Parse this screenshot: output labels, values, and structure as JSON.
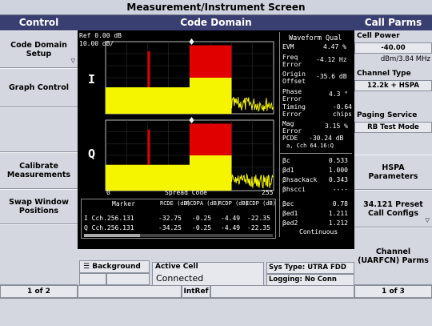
{
  "window": {
    "title": "Measurement/Instrument Screen"
  },
  "left_panel": {
    "header": "Control",
    "keys": [
      {
        "label": "Code Domain Setup",
        "has_menu": true
      },
      {
        "label": "Graph Control",
        "has_menu": false
      },
      {
        "label": "",
        "has_menu": false
      },
      {
        "label": "Calibrate Measurements",
        "has_menu": false
      },
      {
        "label": "Swap Window Positions",
        "has_menu": false
      },
      {
        "label": "",
        "has_menu": false
      }
    ],
    "page_indicator": "1 of 2"
  },
  "center": {
    "header": "Code Domain",
    "ref_label": "Ref 0.00 dB",
    "scale_label": "10.00 dB/",
    "i_label": "I",
    "q_label": "Q",
    "axis_start": "0",
    "axis_title": "Spread Code",
    "axis_end": "255",
    "table": {
      "headers": [
        "Marker",
        "RCDE (dB)",
        "RCDPA (dB)",
        "RCDP (dB)",
        "ECDP (dB)"
      ],
      "rows": [
        [
          "I Cch.256.131",
          "-32.75",
          "-0.25",
          "-4.49",
          "-22.35"
        ],
        [
          "Q Cch.256.131",
          "-34.25",
          "-0.25",
          "-4.49",
          "-22.35"
        ]
      ]
    },
    "waveform": {
      "title": "Waveform Qual",
      "rows": [
        {
          "label": "EVM",
          "value": "4.47 %"
        },
        {
          "label": "Freq Error",
          "value": "-4.12 Hz"
        },
        {
          "label": "Origin Offset",
          "value": "-35.6 dB"
        },
        {
          "label": "Phase Error",
          "value": "4.3 °"
        },
        {
          "label": "Timing Error",
          "value": "-0.64 chips"
        },
        {
          "label": "Mag Error",
          "value": "3.15 %"
        },
        {
          "label": "PCDE",
          "value": "-30.24 dB"
        },
        {
          "label": "",
          "value": "a, Cch 64.16:Q"
        }
      ],
      "gains": [
        {
          "label": "βc",
          "value": "0.533"
        },
        {
          "label": "βd1",
          "value": "1.000"
        },
        {
          "label": "βhsackack",
          "value": "0.343"
        },
        {
          "label": "βhscci",
          "value": "----"
        },
        {
          "label": "βec",
          "value": "0.78"
        },
        {
          "label": "βed1",
          "value": "1.211"
        },
        {
          "label": "βed2",
          "value": "1.212"
        }
      ],
      "mode": "Continuous"
    }
  },
  "right_panel": {
    "header": "Call Parms",
    "cell_power_label": "Cell Power",
    "cell_power_value": "-40.00",
    "cell_power_unit": "dBm/3.84 MHz",
    "channel_type_label": "Channel Type",
    "channel_type_value": "12.2k + HSPA",
    "paging_label": "Paging Service",
    "paging_value": "RB Test Mode",
    "keys": [
      {
        "label": "HSPA Parameters"
      },
      {
        "label": "34.121 Preset Call Configs",
        "has_menu": true
      },
      {
        "label": "Channel (UARFCN) Parms"
      }
    ],
    "page_indicator": "1 of 3"
  },
  "status": {
    "background_label": "Background",
    "active_cell_label": "Active Cell",
    "active_cell_value": "Connected",
    "sys_type": "Sys Type: UTRA FDD",
    "logging": "Logging: No Conn",
    "intref": "IntRef"
  },
  "chart_data": [
    {
      "type": "bar",
      "title": "",
      "series": [
        {
          "name": "I",
          "regions": [
            [
              0,
              64,
              -28
            ],
            [
              64,
              128,
              -15
            ],
            [
              128,
              160,
              -6
            ],
            [
              160,
              192,
              -6
            ]
          ]
        }
      ],
      "xlim": [
        0,
        255
      ],
      "ylabel": "",
      "xlabel": "Spread Code"
    },
    {
      "type": "bar",
      "title": "",
      "series": [
        {
          "name": "Q",
          "regions": [
            [
              0,
              64,
              -28
            ],
            [
              64,
              128,
              -15
            ],
            [
              128,
              160,
              -6
            ],
            [
              160,
              192,
              -6
            ]
          ]
        }
      ],
      "xlim": [
        0,
        255
      ],
      "ylabel": "",
      "xlabel": "Spread Code"
    }
  ],
  "colors": {
    "header_bg": "#3a3f72",
    "trace_yellow": "#f5f500",
    "trace_red": "#e00000",
    "screen_bg": "#000000"
  }
}
